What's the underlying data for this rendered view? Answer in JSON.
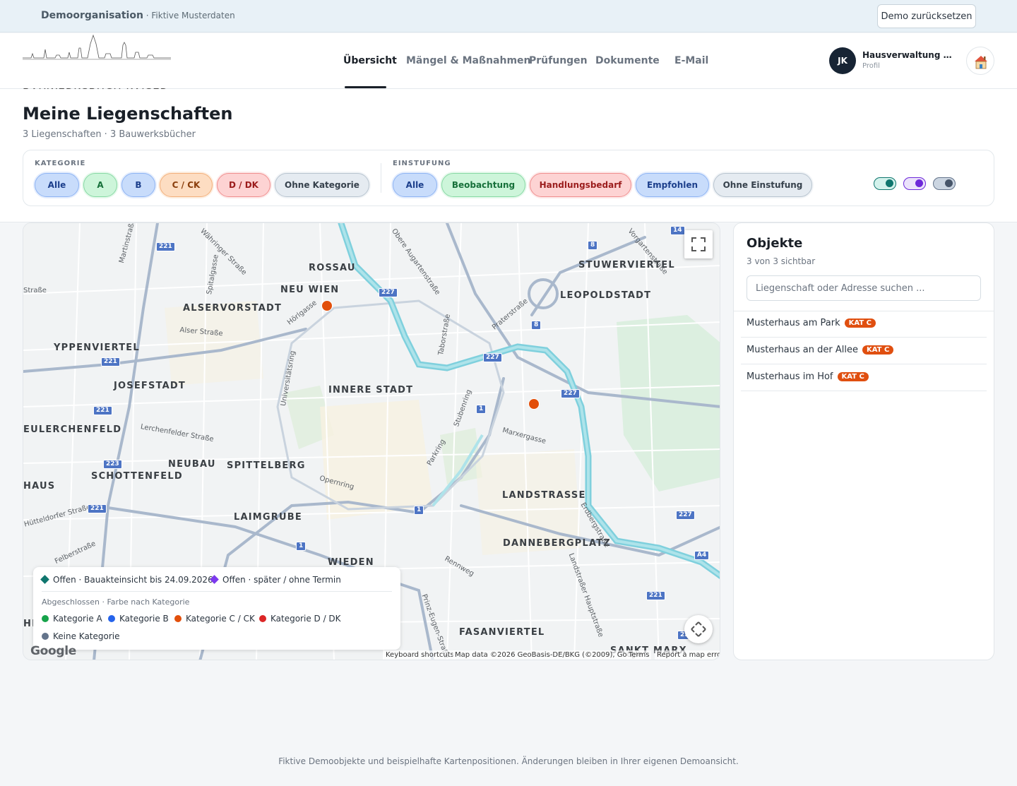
{
  "demo_bar": {
    "org": "Demoorganisation",
    "org_sub": " · Fiktive Musterdaten",
    "reset_label": "Demo zurücksetzen"
  },
  "header": {
    "logo_text": "BAUWERKSBUCH KAISER",
    "nav": [
      {
        "label": "Übersicht",
        "active": true
      },
      {
        "label": "Mängel & Maßnahmen"
      },
      {
        "label": "Prüfungen"
      },
      {
        "label": "Dokumente"
      },
      {
        "label": "E-Mail"
      }
    ],
    "avatar_initials": "JK",
    "profile_name": "Hausverwaltung Muster GmbH",
    "profile_sub": "Profil",
    "profile_icon": "house-icon"
  },
  "page": {
    "title": "Meine Liegenschaften",
    "subtitle": "3 Liegenschaften · 3 Bauwerksbücher"
  },
  "filters": {
    "kategorie_label": "KATEGORIE",
    "kategorie": [
      "Alle",
      "A",
      "B",
      "C / CK",
      "D / DK",
      "Ohne Kategorie"
    ],
    "einstufung_label": "EINSTUFUNG",
    "einstufung": [
      "Alle",
      "Beobachtung",
      "Handlungsbedarf",
      "Empfohlen",
      "Ohne Einstufung"
    ],
    "toggles": [
      {
        "color": "#0f766e",
        "on": true
      },
      {
        "color": "#6d28d9",
        "on": true
      },
      {
        "color": "#475569",
        "on": true
      }
    ]
  },
  "map": {
    "districts": [
      "ROSSAU",
      "NEU WIEN",
      "ALSERVORSTADT",
      "YPPENVIERTEL",
      "JOSEFSTADT",
      "INNERE STADT",
      "LEOPOLDSTADT",
      "STUWERVIERTEL",
      "EULERCHENFELD",
      "NEUBAU",
      "SPITTELBERG",
      "SCHOTTENFELD",
      "HAUS",
      "LAIMGRUBE",
      "LANDSTRASSE",
      "DANNEBERGPLATZ",
      "WIEDEN",
      "FASANVIERTEL",
      "SANKT MARX",
      "HE"
    ],
    "streets": [
      "Martinstraße",
      "Währinger Straße",
      "Spitalgasse",
      "Hörlgasse",
      "Alser Straße",
      "Universitätsring",
      "Lerchenfelder Straße",
      "Obere Augartenstraße",
      "Praterstraße",
      "Taborstraße",
      "Stubenring",
      "Parkring",
      "Marxergasse",
      "Opernring",
      "Hütteldorfer Straße",
      "Felberstraße",
      "Erdbergstraße",
      "Rennweg",
      "Landstraßer Hauptstraße",
      "Prinz-Eugen-Straße",
      "Vorgartenstraße",
      "Straße"
    ],
    "shields": [
      "221",
      "221",
      "221",
      "221",
      "221",
      "223",
      "227",
      "227",
      "227",
      "227",
      "227",
      "8",
      "8",
      "14",
      "1",
      "1",
      "1",
      "A4",
      "221",
      "22"
    ],
    "legend": {
      "offen_bis": "Offen · Bauakteinsicht bis 24.09.2026",
      "offen_spaeter": "Offen · später / ohne Termin",
      "abgeschlossen": "Abgeschlossen · Farbe nach Kategorie",
      "kat_a": "Kategorie A",
      "kat_b": "Kategorie B",
      "kat_c": "Kategorie C / CK",
      "kat_d": "Kategorie D / DK",
      "keine": "Keine Kategorie"
    },
    "google": "Google",
    "attribution": {
      "shortcuts": "Keyboard shortcuts",
      "data": "Map data ©2026 GeoBasis-DE/BKG (©2009), Google",
      "terms": "Terms",
      "report": "Report a map error"
    }
  },
  "objects": {
    "title": "Objekte",
    "count": "3 von 3 sichtbar",
    "search_placeholder": "Liegenschaft oder Adresse suchen ...",
    "items": [
      {
        "name": "Musterhaus am Park",
        "badge": "KAT C"
      },
      {
        "name": "Musterhaus an der Allee",
        "badge": "KAT C"
      },
      {
        "name": "Musterhaus im Hof",
        "badge": "KAT C"
      }
    ]
  },
  "footer": "Fiktive Demoobjekte und beispielhafte Kartenpositionen. Änderungen bleiben in Ihrer eigenen Demoansicht."
}
